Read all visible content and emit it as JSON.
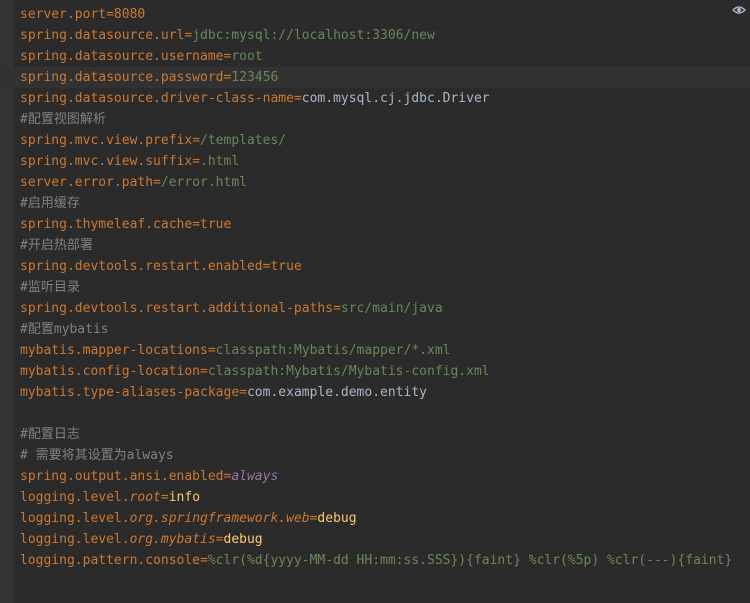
{
  "editor": {
    "lines": [
      {
        "kind": "kv",
        "key": "server.port",
        "value": "8080",
        "vclass": "b"
      },
      {
        "kind": "kv",
        "key": "spring.datasource.url",
        "value": "jdbc:mysql://localhost:3306/new"
      },
      {
        "kind": "kv",
        "key": "spring.datasource.username",
        "value": "root"
      },
      {
        "kind": "kv",
        "key": "spring.datasource.password",
        "value": "123456",
        "current": true
      },
      {
        "kind": "kv",
        "key": "spring.datasource.driver-class-name",
        "value": "com.mysql.cj.jdbc.Driver",
        "vclass": "plain"
      },
      {
        "kind": "comment",
        "text": "#配置视图解析"
      },
      {
        "kind": "kv",
        "key": "spring.mvc.view.prefix",
        "value": "/templates/"
      },
      {
        "kind": "kv",
        "key": "spring.mvc.view.suffix",
        "value": ".html"
      },
      {
        "kind": "kv",
        "key": "server.error.path",
        "value": "/error.html"
      },
      {
        "kind": "comment",
        "text": "#启用缓存"
      },
      {
        "kind": "kv",
        "key": "spring.thymeleaf.cache",
        "value": "true",
        "vclass": "b"
      },
      {
        "kind": "comment",
        "text": "#开启热部署"
      },
      {
        "kind": "kv",
        "key": "spring.devtools.restart.enabled",
        "value": "true",
        "vclass": "b"
      },
      {
        "kind": "comment",
        "text": "#监听目录"
      },
      {
        "kind": "kv",
        "key": "spring.devtools.restart.additional-paths",
        "value": "src/main/java"
      },
      {
        "kind": "comment",
        "text": "#配置mybatis"
      },
      {
        "kind": "kv",
        "key": "mybatis.mapper-locations",
        "value": "classpath:Mybatis/mapper/*.xml"
      },
      {
        "kind": "kv",
        "key": "mybatis.config-location",
        "value": "classpath:Mybatis/Mybatis-config.xml"
      },
      {
        "kind": "kv",
        "key": "mybatis.type-aliases-package",
        "value": "com.example.demo.entity",
        "vclass": "plain"
      },
      {
        "kind": "blank"
      },
      {
        "kind": "comment",
        "text": "#配置日志"
      },
      {
        "kind": "comment",
        "text": "# 需要将其设置为always"
      },
      {
        "kind": "kv",
        "key": "spring.output.ansi.enabled",
        "value": "always",
        "vclass": "vi"
      },
      {
        "kind": "kv3",
        "prefix": "logging.level.",
        "ital": "root",
        "value": "info"
      },
      {
        "kind": "kv3",
        "prefix": "logging.level.",
        "ital": "org.springframework.web",
        "value": "debug"
      },
      {
        "kind": "kv3",
        "prefix": "logging.level.",
        "ital": "org.mybatis",
        "value": "debug"
      },
      {
        "kind": "kv",
        "key": "logging.pattern.console",
        "value": "%clr(%d{yyyy-MM-dd HH:mm:ss.SSS}){faint} %clr(%5p) %clr(---){faint}"
      }
    ]
  },
  "icons": {
    "eye": "eye-icon"
  }
}
